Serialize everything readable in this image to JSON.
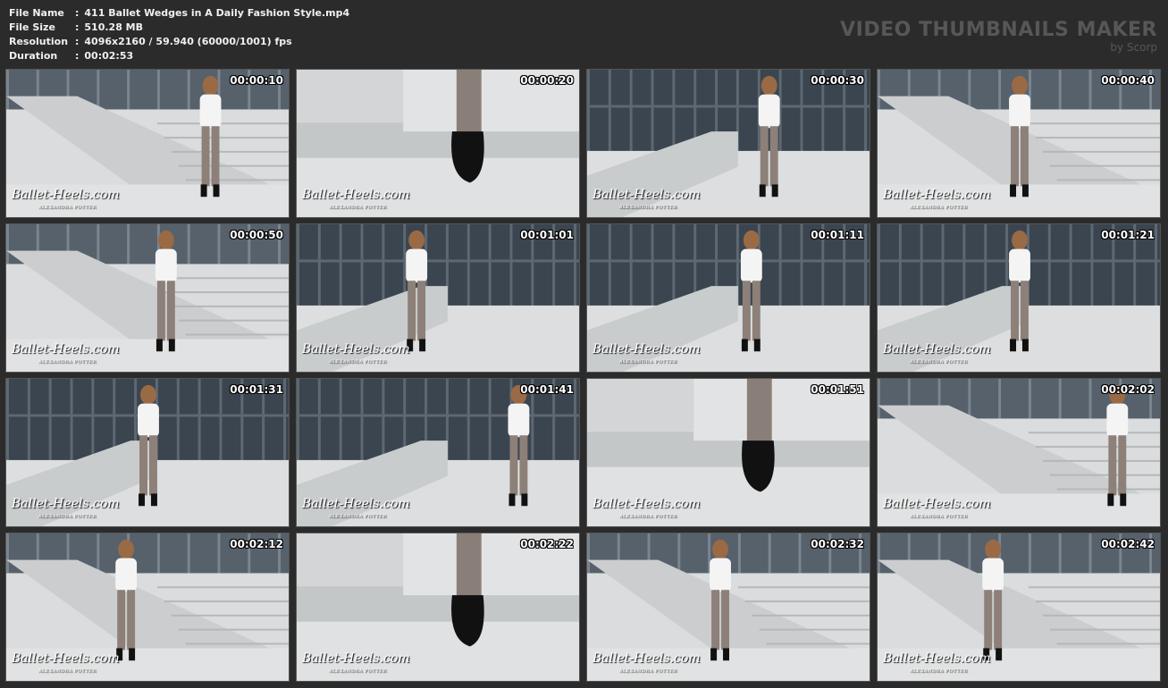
{
  "file_info": [
    {
      "label": "File Name",
      "value": "411 Ballet Wedges in A Daily Fashion Style.mp4"
    },
    {
      "label": "File Size",
      "value": "510.28 MB"
    },
    {
      "label": "Resolution",
      "value": "4096x2160 / 59.940 (60000/1001) fps"
    },
    {
      "label": "Duration",
      "value": "00:02:53"
    }
  ],
  "brand": {
    "title": "VIDEO THUMBNAILS MAKER",
    "subtitle": "by Scorp"
  },
  "watermark": {
    "main": "Ballet-Heels.com",
    "sub": "ALEXANDRA POTTER"
  },
  "thumbnails": [
    {
      "time": "00:00:10"
    },
    {
      "time": "00:00:20"
    },
    {
      "time": "00:00:30"
    },
    {
      "time": "00:00:40"
    },
    {
      "time": "00:00:50"
    },
    {
      "time": "00:01:01"
    },
    {
      "time": "00:01:11"
    },
    {
      "time": "00:01:21"
    },
    {
      "time": "00:01:31"
    },
    {
      "time": "00:01:41"
    },
    {
      "time": "00:01:51"
    },
    {
      "time": "00:02:02"
    },
    {
      "time": "00:02:12"
    },
    {
      "time": "00:02:22"
    },
    {
      "time": "00:02:32"
    },
    {
      "time": "00:02:42"
    }
  ]
}
